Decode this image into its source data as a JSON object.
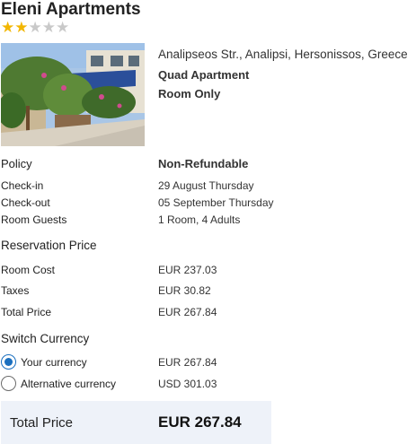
{
  "hotel": {
    "name": "Eleni Apartments",
    "rating": 2,
    "max_rating": 5,
    "star_color": "#f2b600",
    "address": "Analipseos Str., Analipsi, Hersonissos, Greece",
    "room_type": "Quad Apartment",
    "board": "Room Only"
  },
  "details": {
    "policy_label": "Policy",
    "policy_value": "Non-Refundable",
    "checkin_label": "Check-in",
    "checkin_value": "29 August Thursday",
    "checkout_label": "Check-out",
    "checkout_value": "05 September Thursday",
    "guests_label": "Room Guests",
    "guests_value": "1 Room, 4 Adults"
  },
  "reservation": {
    "title": "Reservation Price",
    "room_cost_label": "Room Cost",
    "room_cost_value": "EUR 237.03",
    "taxes_label": "Taxes",
    "taxes_value": "EUR 30.82",
    "total_label": "Total Price",
    "total_value": "EUR 267.84"
  },
  "currency": {
    "title": "Switch Currency",
    "options": [
      {
        "label": "Your currency",
        "value": "EUR 267.84",
        "selected": true
      },
      {
        "label": "Alternative currency",
        "value": "USD 301.03",
        "selected": false
      }
    ],
    "accent": "#1a6fbf"
  },
  "summary": {
    "label": "Total Price",
    "value": "EUR 267.84",
    "background": "#eef2f9"
  }
}
